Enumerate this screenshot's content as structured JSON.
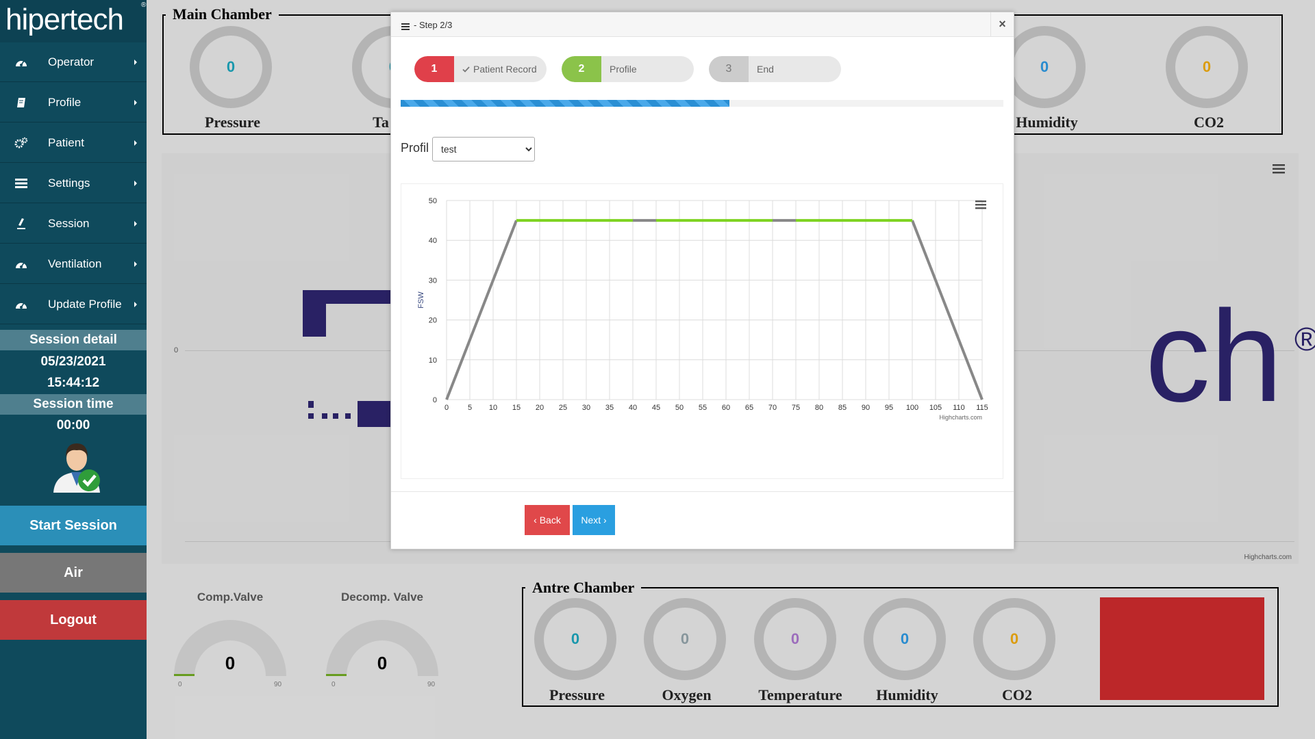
{
  "brand": {
    "logo": "hipertech",
    "reg": "®"
  },
  "sidebar": {
    "items": [
      {
        "label": "Operator",
        "icon": "dashboard-icon"
      },
      {
        "label": "Profile",
        "icon": "book-icon"
      },
      {
        "label": "Patient",
        "icon": "cogs-icon"
      },
      {
        "label": "Settings",
        "icon": "list-icon"
      },
      {
        "label": "Session",
        "icon": "flask-icon"
      },
      {
        "label": "Ventilation",
        "icon": "dashboard-icon"
      },
      {
        "label": "Update Profile",
        "icon": "dashboard-icon"
      }
    ],
    "session_detail_label": "Session detail",
    "date": "05/23/2021",
    "time": "15:44:12",
    "session_time_label": "Session time",
    "session_time": "00:00",
    "start_session": "Start Session",
    "air": "Air",
    "logout": "Logout"
  },
  "main_chamber": {
    "title": "Main Chamber",
    "gauges": [
      {
        "label": "Pressure",
        "value": "0",
        "color": "#1a9bb0"
      },
      {
        "label": "Ta",
        "value": "0",
        "color": "#1a9bb0"
      },
      {
        "label": "Humidity",
        "value": "0",
        "color": "#2a8fd4"
      },
      {
        "label": "CO2",
        "value": "0",
        "color": "#e0a010"
      }
    ]
  },
  "background_chart": {
    "zero_label": "0",
    "credit": "Highcharts.com"
  },
  "valves": [
    {
      "title": "Comp.Valve",
      "value": "0",
      "min": "0",
      "max": "90"
    },
    {
      "title": "Decomp. Valve",
      "value": "0",
      "min": "0",
      "max": "90"
    }
  ],
  "antre_chamber": {
    "title": "Antre Chamber",
    "gauges": [
      {
        "label": "Pressure",
        "value": "0",
        "color": "#1a9bb0"
      },
      {
        "label": "Oxygen",
        "value": "0",
        "color": "#8a9aa0"
      },
      {
        "label": "Temperature",
        "value": "0",
        "color": "#a070c0"
      },
      {
        "label": "Humidity",
        "value": "0",
        "color": "#2a8fd4"
      },
      {
        "label": "CO2",
        "value": "0",
        "color": "#e0a010"
      }
    ],
    "status_color": "#c0282a"
  },
  "modal": {
    "title": "- Step 2/3",
    "close": "×",
    "steps": [
      {
        "num": "1",
        "label": "Patient Record",
        "done": true,
        "color": "#e0404a"
      },
      {
        "num": "2",
        "label": "Profile",
        "done": false,
        "color": "#8bc34a"
      },
      {
        "num": "3",
        "label": "End",
        "done": false,
        "color": "#cccccc"
      }
    ],
    "progress": 0.545,
    "profil_label": "Profil",
    "profil_selected": "test",
    "back": "‹ Back",
    "next": "Next ›"
  },
  "chart_data": {
    "type": "line",
    "title": "",
    "xlabel": "",
    "ylabel": "FSW",
    "xlim": [
      0,
      115
    ],
    "ylim": [
      0,
      50
    ],
    "xticks": [
      0,
      5,
      10,
      15,
      20,
      25,
      30,
      35,
      40,
      45,
      50,
      55,
      60,
      65,
      70,
      75,
      80,
      85,
      90,
      95,
      100,
      105,
      110,
      115
    ],
    "yticks": [
      0,
      10,
      20,
      30,
      40,
      50
    ],
    "credit": "Highcharts.com",
    "series": [
      {
        "color": "#888888",
        "segments": [
          {
            "x": [
              0,
              15
            ],
            "y": [
              0,
              45
            ]
          },
          {
            "x": [
              40,
              45
            ],
            "y": [
              45,
              45
            ]
          },
          {
            "x": [
              70,
              75
            ],
            "y": [
              45,
              45
            ]
          },
          {
            "x": [
              100,
              115
            ],
            "y": [
              45,
              0
            ]
          }
        ]
      },
      {
        "color": "#7ed321",
        "segments": [
          {
            "x": [
              15,
              40
            ],
            "y": [
              45,
              45
            ]
          },
          {
            "x": [
              45,
              70
            ],
            "y": [
              45,
              45
            ]
          },
          {
            "x": [
              75,
              100
            ],
            "y": [
              45,
              45
            ]
          }
        ]
      }
    ]
  }
}
